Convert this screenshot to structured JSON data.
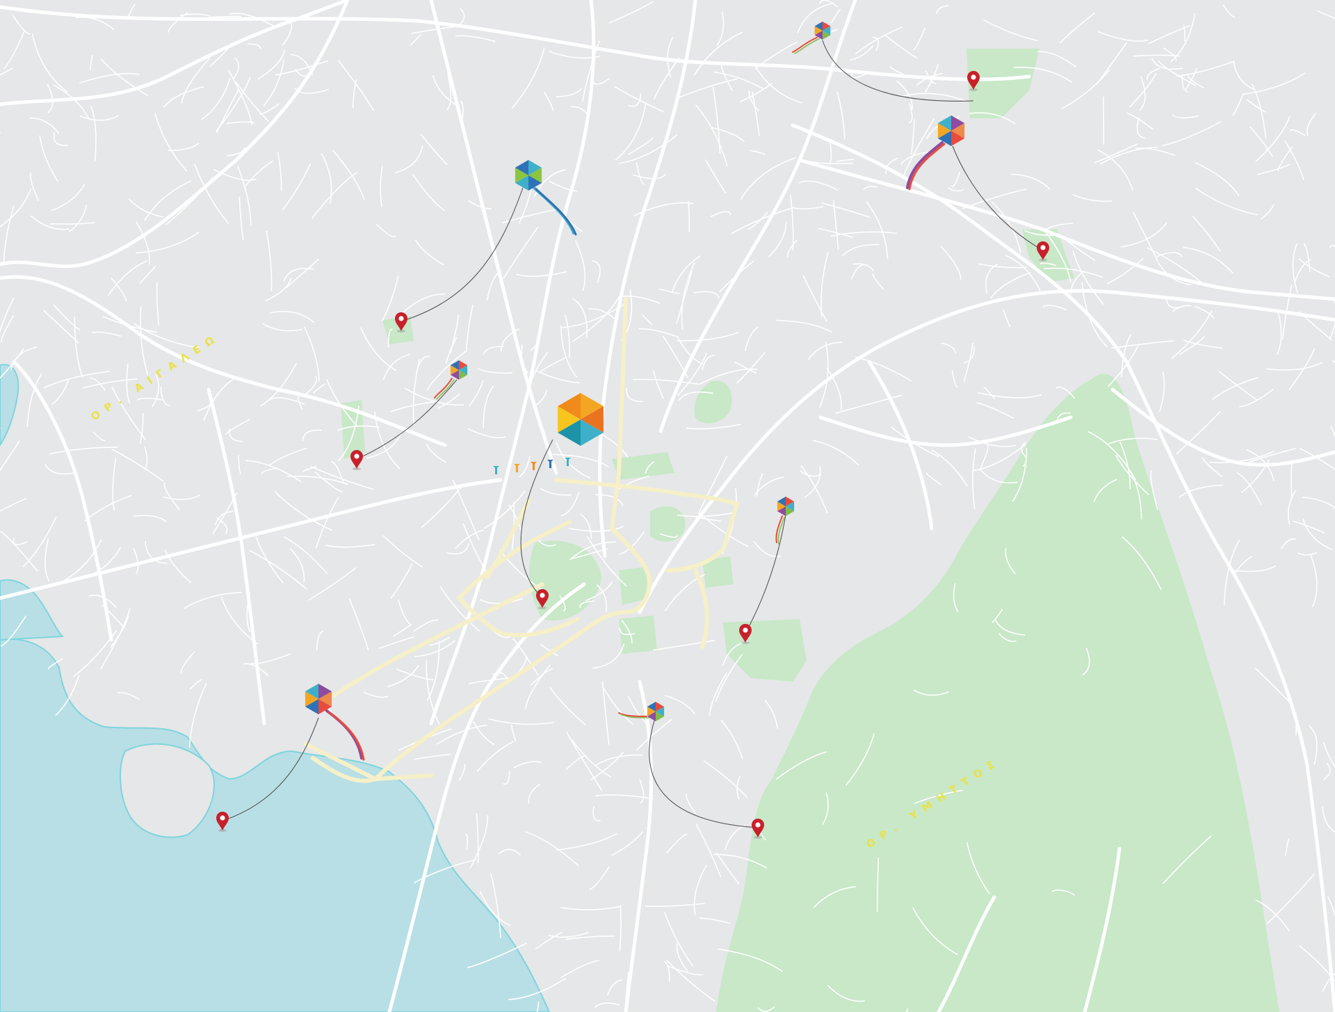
{
  "colors": {
    "land": "#e6e7e8",
    "road": "#ffffff",
    "main_road": "#f6f0c8",
    "park": "#c8e8c8",
    "water": "#b8dfe6",
    "coast": "#7fd4dc",
    "pin": "#c8202b",
    "tether": "#555555",
    "mountain_label": "#e8e24a"
  },
  "mountain_labels": {
    "west": "ΟΡ. ΑΙΓΑΛΕΩ",
    "east": "ΟΡ. ΥΜΗΤΤΟΣ"
  },
  "markers": [
    {
      "name": "kite-marker-north-1",
      "kite_palette": [
        "#e94b3c",
        "#3fb0c9",
        "#7dbd4b",
        "#8e4b9f",
        "#f4a623",
        "#2f72b8"
      ],
      "size": "small"
    },
    {
      "name": "kite-marker-north-2",
      "kite_palette": [
        "#8e4b9f",
        "#f08a4b",
        "#e94b3c",
        "#2f72b8",
        "#f4a623",
        "#3fb0c9"
      ],
      "size": "medium"
    },
    {
      "name": "kite-marker-north-west",
      "kite_palette": [
        "#3fb0c9",
        "#8cc63f",
        "#2f72b8",
        "#3fb0c9",
        "#8cc63f",
        "#2f72b8"
      ],
      "size": "medium"
    },
    {
      "name": "kite-marker-center-west",
      "kite_palette": [
        "#e94b3c",
        "#3fb0c9",
        "#7dbd4b",
        "#8e4b9f",
        "#f4a623",
        "#2f72b8"
      ],
      "size": "small"
    },
    {
      "name": "kite-marker-center-main",
      "kite_palette": [
        "#f4a623",
        "#e9731f",
        "#3fb0c9",
        "#1d93a8",
        "#f7c51e",
        "#f08a1b"
      ],
      "size": "large"
    },
    {
      "name": "kite-marker-east",
      "kite_palette": [
        "#e94b3c",
        "#3fb0c9",
        "#7dbd4b",
        "#8e4b9f",
        "#f4a623",
        "#2f72b8"
      ],
      "size": "small"
    },
    {
      "name": "kite-marker-south",
      "kite_palette": [
        "#e94b3c",
        "#3fb0c9",
        "#7dbd4b",
        "#8e4b9f",
        "#f4a623",
        "#2f72b8"
      ],
      "size": "small"
    },
    {
      "name": "kite-marker-piraeus",
      "kite_palette": [
        "#8e4b9f",
        "#f08a4b",
        "#e94b3c",
        "#2f72b8",
        "#f4a623",
        "#3fb0c9"
      ],
      "size": "medium"
    }
  ]
}
